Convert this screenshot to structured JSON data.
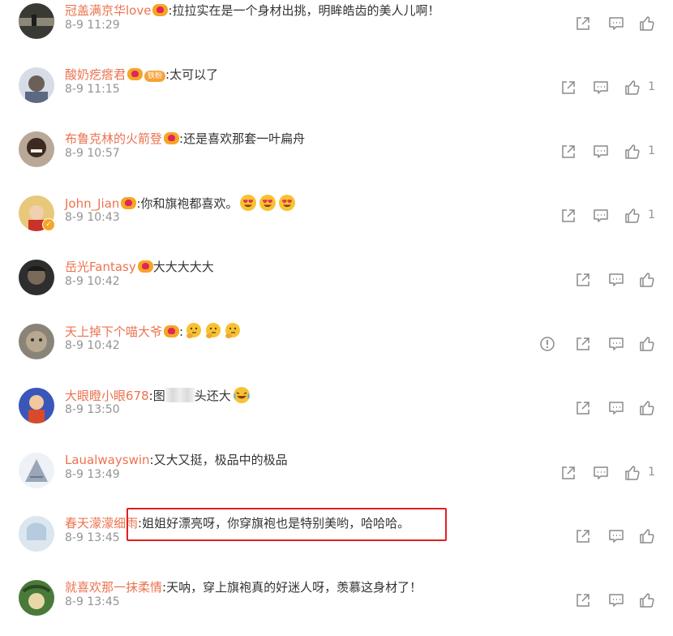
{
  "colors": {
    "username": "#eb7350",
    "meta": "#939393",
    "highlight": "#e02020"
  },
  "comments": [
    {
      "user": "冠盖满京华love",
      "sep": ":",
      "text": "拉拉实在是一个身材出挑，明眸皓齿的美人儿啊！",
      "time": "8-9 11:29",
      "likes": "",
      "emoji": []
    },
    {
      "user": "酸奶疙瘩君",
      "sep": ":",
      "text": "太可以了",
      "time": "8-9 11:15",
      "likes": "1",
      "fan_badge": "铁粉",
      "emoji": []
    },
    {
      "user": "布鲁克林的火箭登",
      "sep": ":",
      "text": "还是喜欢那套一叶扁舟",
      "time": "8-9 10:57",
      "likes": "1",
      "emoji": []
    },
    {
      "user": "John_Jian",
      "sep": ":",
      "text": "你和旗袍都喜欢。",
      "time": "8-9 10:43",
      "likes": "1",
      "emoji": [
        "heart-eyes-emoji",
        "heart-eyes-emoji",
        "heart-eyes-emoji"
      ]
    },
    {
      "user": "岳光Fantasy",
      "sep": "",
      "text": "大大大大大",
      "time": "8-9 10:42",
      "likes": "",
      "emoji": []
    },
    {
      "user": "天上掉下个喵大爷",
      "sep": ":",
      "text": "",
      "time": "8-9 10:42",
      "likes": "",
      "emoji": [
        "thinking-emoji",
        "thinking-emoji",
        "thinking-emoji"
      ]
    },
    {
      "user": "大眼瞪小眼678",
      "sep": ":",
      "text_a": "图",
      "text_b": "头还大",
      "time": "8-9 13:50",
      "likes": "",
      "emoji": [
        "laughing-crying-emoji"
      ]
    },
    {
      "user": "Laualwayswin",
      "sep": ":",
      "text": "又大又挺，极品中的极品",
      "time": "8-9 13:49",
      "likes": "1",
      "emoji": []
    },
    {
      "user": "春天濛濛细雨",
      "sep": ":",
      "text": "姐姐好漂亮呀，你穿旗袍也是特别美哟，哈哈哈。",
      "time": "8-9 13:45",
      "likes": "",
      "emoji": []
    },
    {
      "user": "就喜欢那一抹柔情",
      "sep": ":",
      "text": "天呐，穿上旗袍真的好迷人呀，羡慕这身材了！",
      "time": "8-9 13:45",
      "likes": "",
      "emoji": []
    }
  ]
}
